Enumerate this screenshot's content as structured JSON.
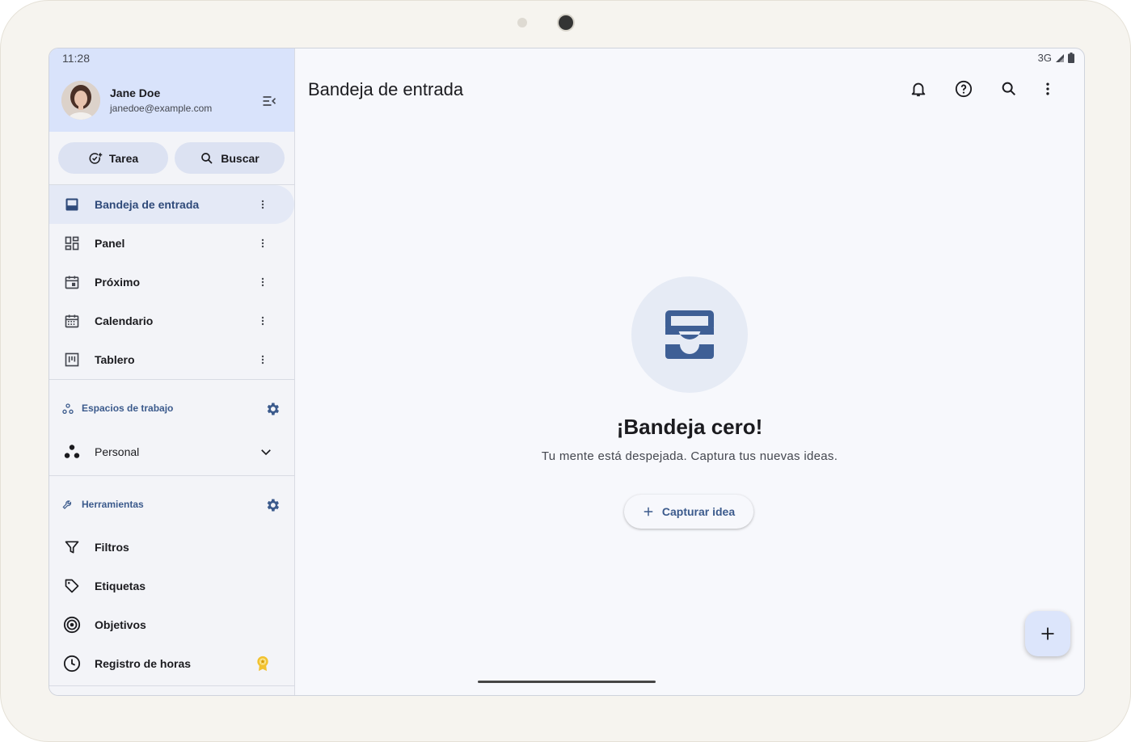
{
  "status_bar": {
    "time": "11:28",
    "network": "3G"
  },
  "user": {
    "name": "Jane Doe",
    "email": "janedoe@example.com"
  },
  "quick_actions": {
    "task_label": "Tarea",
    "search_label": "Buscar"
  },
  "nav_items": [
    {
      "label": "Bandeja de entrada",
      "icon": "inbox-icon",
      "active": true
    },
    {
      "label": "Panel",
      "icon": "dashboard-icon"
    },
    {
      "label": "Próximo",
      "icon": "upcoming-calendar-icon"
    },
    {
      "label": "Calendario",
      "icon": "calendar-grid-icon"
    },
    {
      "label": "Tablero",
      "icon": "board-icon"
    }
  ],
  "workspaces": {
    "section_label": "Espacios de trabajo",
    "selected": "Personal"
  },
  "tools": {
    "section_label": "Herramientas",
    "items": [
      {
        "label": "Filtros",
        "icon": "filter-icon"
      },
      {
        "label": "Etiquetas",
        "icon": "tag-icon"
      },
      {
        "label": "Objetivos",
        "icon": "target-icon"
      },
      {
        "label": "Registro de horas",
        "icon": "clock-icon",
        "badge": "premium-badge-icon"
      }
    ]
  },
  "main": {
    "title": "Bandeja de entrada",
    "empty_title": "¡Bandeja cero!",
    "empty_subtitle": "Tu mente está despejada. Captura tus nuevas ideas.",
    "capture_label": "Capturar idea"
  },
  "colors": {
    "accent": "#3b5a8c",
    "sidebar_header": "#d9e3fb",
    "badge": "#f2c230"
  }
}
